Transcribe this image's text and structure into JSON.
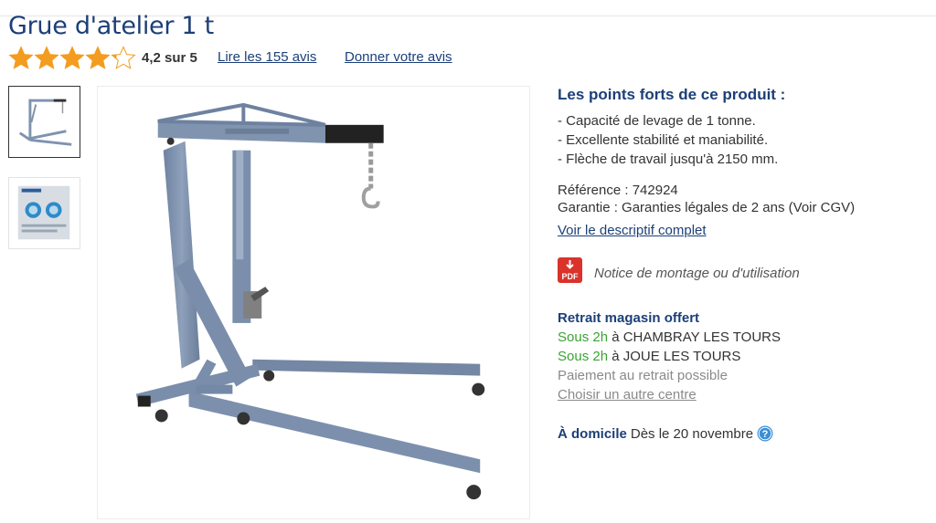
{
  "product": {
    "title": "Grue d'atelier 1 t",
    "rating_value": 4.2,
    "rating_text": "4,2 sur 5",
    "read_reviews": "Lire les 155 avis",
    "give_review": "Donner votre avis"
  },
  "colors": {
    "brand": "#1c3f78",
    "star": "#f39c1f",
    "availability_green": "#3aa335",
    "pdf_red": "#d9332b",
    "crane_gray": "#7f93ad"
  },
  "strengths": {
    "title": "Les points forts de ce produit :",
    "items": [
      "- Capacité de levage de 1 tonne.",
      "- Excellente stabilité et maniabilité.",
      "- Flèche de travail jusqu'à 2150 mm."
    ]
  },
  "info": {
    "reference": "Référence : 742924",
    "warranty": "Garantie : Garanties légales de 2 ans (Voir CGV)",
    "description_link": "Voir le descriptif complet"
  },
  "notice": {
    "icon": "pdf-icon",
    "icon_label": "PDF",
    "label": "Notice de montage ou d'utilisation"
  },
  "pickup": {
    "title": "Retrait magasin offert",
    "stores": [
      {
        "delay": "Sous 2h",
        "name": "à CHAMBRAY LES TOURS"
      },
      {
        "delay": "Sous 2h",
        "name": "à JOUE LES TOURS"
      }
    ],
    "payment": "Paiement au retrait possible",
    "choose_other": "Choisir un autre centre"
  },
  "home_delivery": {
    "label": "À domicile",
    "date": "Dès le 20 novembre",
    "icon": "help-icon"
  }
}
